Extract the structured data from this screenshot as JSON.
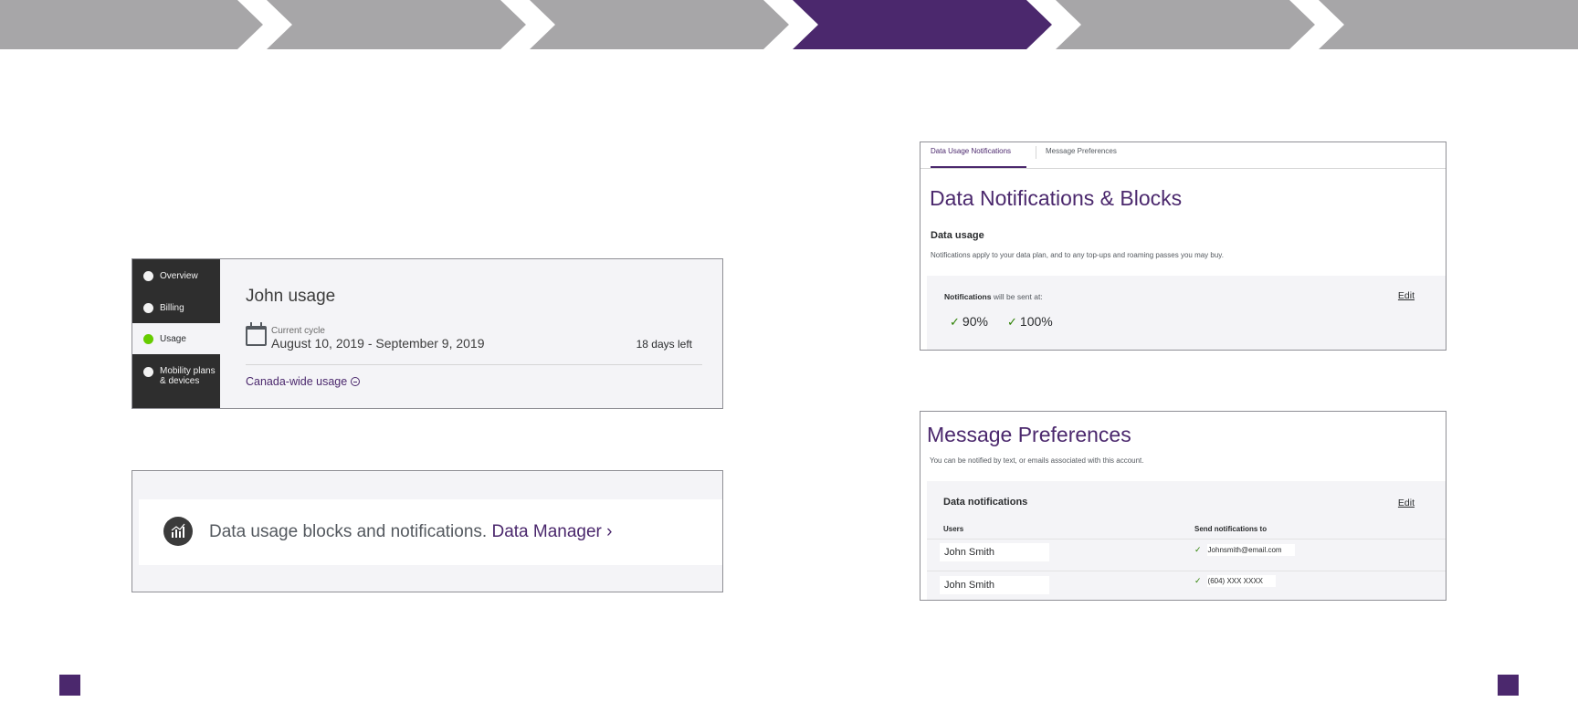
{
  "stepper": {
    "steps": 6,
    "active_index": 3,
    "colors": {
      "inactive": "#a7a6a8",
      "active": "#4b286d"
    }
  },
  "usage_panel": {
    "nav": [
      {
        "label_lines": [
          "Overview"
        ],
        "icon": "user-icon",
        "active": false
      },
      {
        "label_lines": [
          "Billing"
        ],
        "icon": "dollar-icon",
        "active": false
      },
      {
        "label_lines": [
          "Usage"
        ],
        "icon": "usage-icon",
        "active": true
      },
      {
        "label_lines": [
          "Mobility plans",
          "& devices"
        ],
        "icon": "phone-icon",
        "active": false
      }
    ],
    "title": "John usage",
    "cycle_label": "Current cycle",
    "cycle_dates": "August 10, 2019 - September 9, 2019",
    "days_left": "18 days left",
    "canada_link": "Canada-wide usage"
  },
  "data_manager_panel": {
    "text": "Data usage blocks and notifications.",
    "link": "Data Manager",
    "chevron": "›"
  },
  "notifications_panel": {
    "tabs": [
      "Data Usage Notifications",
      "Message Preferences"
    ],
    "title": "Data Notifications & Blocks",
    "subtitle": "Data usage",
    "description": "Notifications apply to your data plan, and to any top-ups and roaming passes you may buy.",
    "sent_bold": "Notifications",
    "sent_rest": " will be sent at:",
    "edit": "Edit",
    "thresholds": [
      {
        "value": "90",
        "unit": "%"
      },
      {
        "value": "100",
        "unit": "%"
      }
    ]
  },
  "preferences_panel": {
    "title": "Message Preferences",
    "description": "You can be notified by text, or emails associated with this account.",
    "section": "Data notifications",
    "edit": "Edit",
    "columns": [
      "Users",
      "Send notifications to"
    ],
    "rows": [
      {
        "user": "John Smith",
        "destination": "Johnsmith@email.com"
      },
      {
        "user": "John Smith",
        "destination": "(604) XXX XXXX"
      }
    ]
  }
}
